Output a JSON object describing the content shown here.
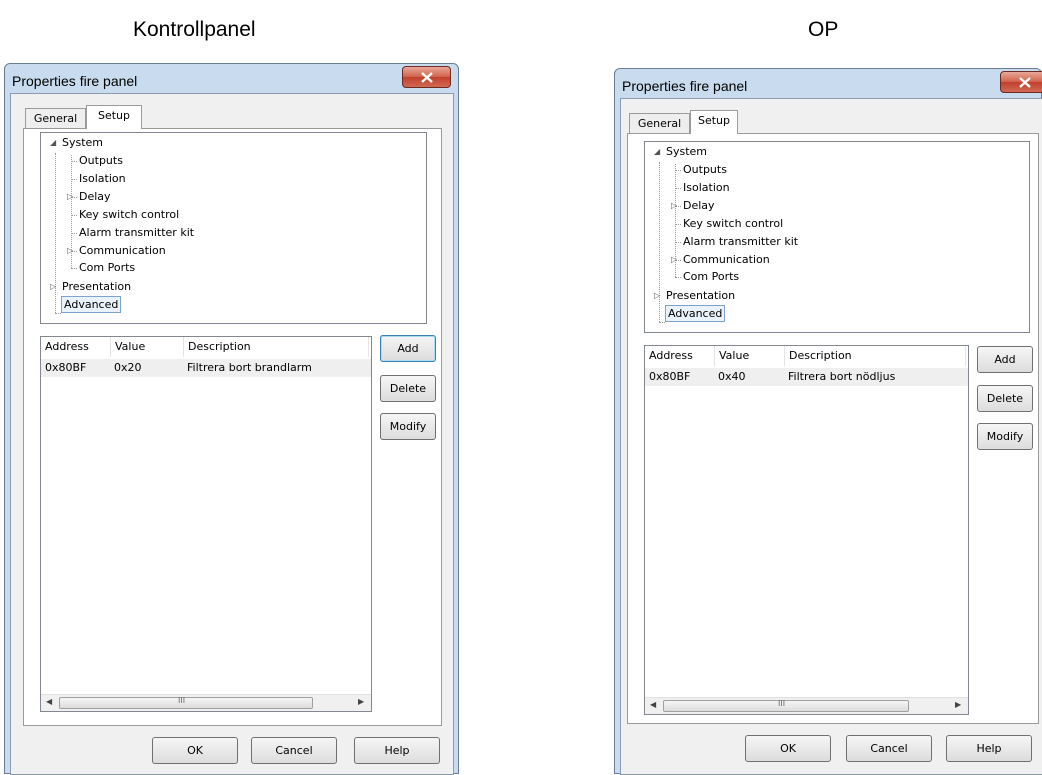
{
  "captions": {
    "left": "Kontrollpanel",
    "right": "OP"
  },
  "dialog": {
    "title": "Properties fire panel",
    "tabs": [
      "General",
      "Setup"
    ],
    "tree": {
      "system": "System",
      "children": [
        "Outputs",
        "Isolation",
        "Delay",
        "Key switch control",
        "Alarm transmitter kit",
        "Communication",
        "Com Ports"
      ],
      "presentation": "Presentation",
      "advanced": "Advanced"
    },
    "list_headers": [
      "Address",
      "Value",
      "Description"
    ],
    "side_buttons": [
      "Add",
      "Delete",
      "Modify"
    ],
    "footer_buttons": [
      "OK",
      "Cancel",
      "Help"
    ],
    "scroll_grip": "III"
  },
  "left_dialog_row": {
    "address": "0x80BF",
    "value": "0x20",
    "description": "Filtrera bort brandlarm"
  },
  "right_dialog_row": {
    "address": "0x80BF",
    "value": "0x40",
    "description": "Filtrera bort nödljus"
  },
  "icons": {
    "close": "close-icon",
    "expanded": "tree-expanded-icon",
    "collapsed": "tree-collapsed-icon",
    "scroll_left": "scroll-left-icon",
    "scroll_right": "scroll-right-icon"
  },
  "colors": {
    "frame": "#c9dbee",
    "close_button": "#c0402c",
    "client": "#f0f0f0"
  }
}
